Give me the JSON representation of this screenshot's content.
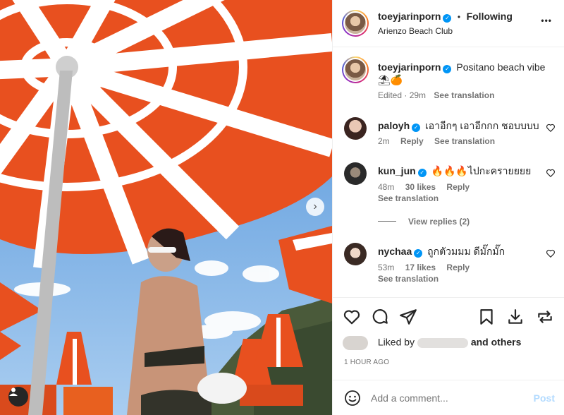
{
  "header": {
    "username": "toeyjarinporn",
    "follow_status": "Following",
    "location": "Arienzo Beach Club",
    "more_label": "•••",
    "dot": "•"
  },
  "caption": {
    "username": "toeyjarinporn",
    "text": "Positano beach vibe",
    "emoji": "⛱🍊",
    "edited": "Edited",
    "time": "29m",
    "see_translation": "See translation"
  },
  "comments": [
    {
      "username": "paloyh",
      "text": "เอาอีกๆ เอาอีกกก ชอบบบบ",
      "time": "2m",
      "reply": "Reply",
      "see_translation": "See translation"
    },
    {
      "username": "kun_jun",
      "text": "🔥🔥🔥ไปกะครายยยย",
      "time": "48m",
      "likes": "30 likes",
      "reply": "Reply",
      "see_translation": "See translation",
      "view_replies": "View replies (2)"
    },
    {
      "username": "nychaa",
      "text": "ถูกตัวมมม ดีมั๊กมั๊ก",
      "time": "53m",
      "likes": "17 likes",
      "reply": "Reply",
      "see_translation": "See translation"
    }
  ],
  "engagement": {
    "liked_by_prefix": "Liked by",
    "liked_by_suffix": "and others",
    "timestamp": "1 HOUR AGO"
  },
  "composer": {
    "placeholder": "Add a comment...",
    "post_label": "Post"
  },
  "icons": {
    "like": "heart-icon",
    "comment": "comment-icon",
    "share": "share-icon",
    "save": "bookmark-icon",
    "download": "download-icon",
    "repost": "repost-icon",
    "emoji": "emoji-icon",
    "next": "chevron-right-icon",
    "tags": "user-tag-icon"
  },
  "colors": {
    "accent": "#0095f6",
    "umbrella_red": "#e8501f",
    "text": "#262626",
    "muted": "#737373"
  }
}
